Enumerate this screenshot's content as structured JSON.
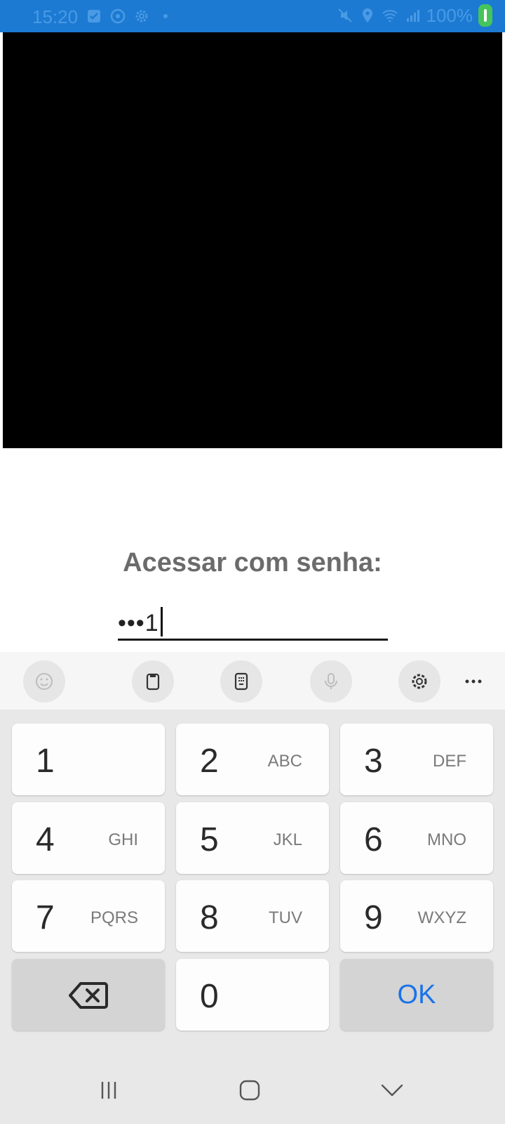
{
  "status_bar": {
    "time": "15:20",
    "battery": "100%",
    "icons_left": [
      "check-box-icon",
      "sync-icon",
      "settings-icon",
      "dot-icon"
    ],
    "icons_right": [
      "mute-icon",
      "location-icon",
      "wifi-icon",
      "signal-icon",
      "battery-icon"
    ]
  },
  "login": {
    "title": "Acessar com senha:",
    "password_value": "•••1"
  },
  "keyboard_toolbar": {
    "buttons": [
      "emoji-icon",
      "clipboard-icon",
      "keypad-icon",
      "microphone-icon",
      "settings-icon",
      "more-icon"
    ]
  },
  "keypad": {
    "keys": [
      {
        "digit": "1",
        "letters": ""
      },
      {
        "digit": "2",
        "letters": "ABC"
      },
      {
        "digit": "3",
        "letters": "DEF"
      },
      {
        "digit": "4",
        "letters": "GHI"
      },
      {
        "digit": "5",
        "letters": "JKL"
      },
      {
        "digit": "6",
        "letters": "MNO"
      },
      {
        "digit": "7",
        "letters": "PQRS"
      },
      {
        "digit": "8",
        "letters": "TUV"
      },
      {
        "digit": "9",
        "letters": "WXYZ"
      },
      {
        "digit": "0",
        "letters": ""
      }
    ],
    "ok_label": "OK"
  },
  "nav_bar": {
    "buttons": [
      "recents-icon",
      "home-icon",
      "back-icon"
    ]
  }
}
